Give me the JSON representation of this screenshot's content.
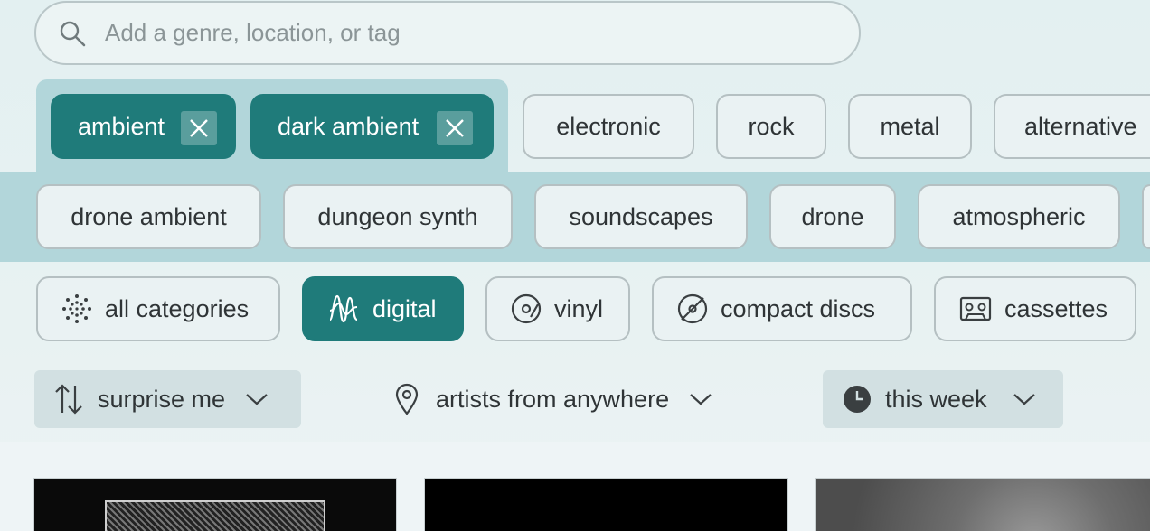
{
  "search": {
    "placeholder": "Add a genre, location, or tag"
  },
  "selected_tags": [
    {
      "label": "ambient"
    },
    {
      "label": "dark ambient"
    }
  ],
  "suggested_tags_row1": [
    "electronic",
    "rock",
    "metal",
    "alternative"
  ],
  "suggested_tags_row2": [
    "drone ambient",
    "dungeon synth",
    "soundscapes",
    "drone",
    "atmospheric"
  ],
  "formats": {
    "all": "all categories",
    "digital": "digital",
    "vinyl": "vinyl",
    "cd": "compact discs",
    "cassette": "cassettes",
    "active": "digital"
  },
  "filters": {
    "sort": "surprise me",
    "location": "artists from anywhere",
    "time": "this week"
  },
  "colors": {
    "accent": "#1f7b7a",
    "band": "#b2d6da",
    "background": "#e3f0f1"
  }
}
